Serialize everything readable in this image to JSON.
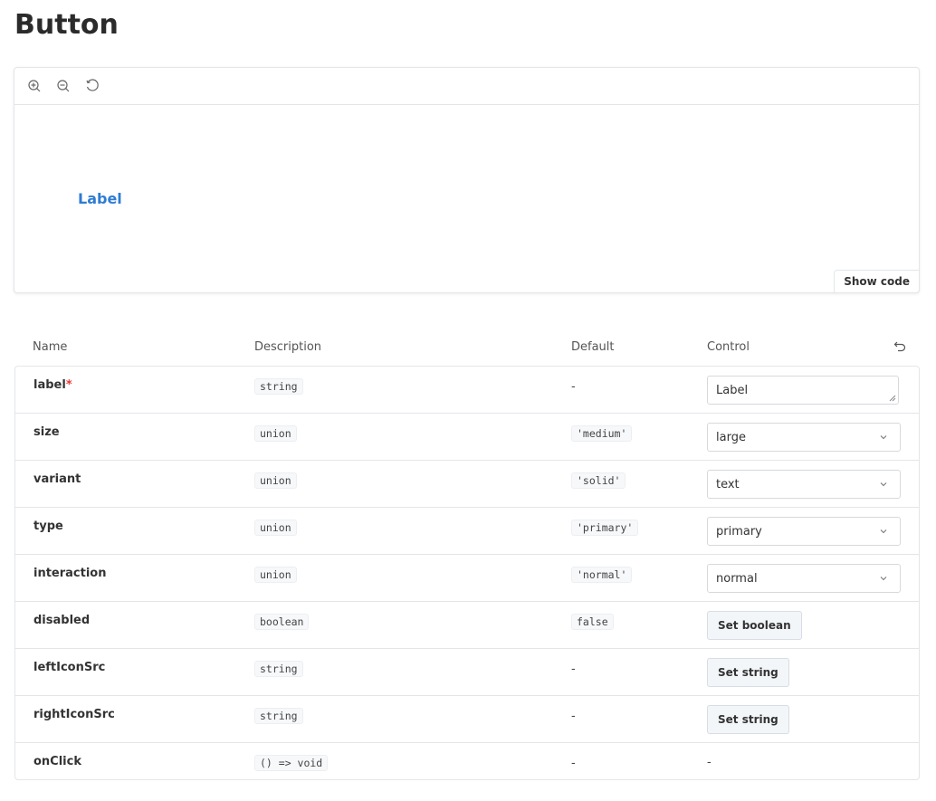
{
  "page": {
    "title": "Button"
  },
  "toolbar": {
    "zoom_in_icon": "zoom-in-icon",
    "zoom_out_icon": "zoom-out-icon",
    "reset_zoom_icon": "reset-zoom-icon"
  },
  "preview": {
    "button_label": "Label",
    "button_color": "#2f7cd3",
    "show_code_label": "Show code"
  },
  "args_table": {
    "headers": {
      "name": "Name",
      "description": "Description",
      "default": "Default",
      "control": "Control"
    },
    "reset_icon": "undo-icon",
    "required_marker": "*",
    "rows": [
      {
        "name": "label",
        "required": true,
        "type": "string",
        "default": "-",
        "control": {
          "kind": "text",
          "value": "Label"
        }
      },
      {
        "name": "size",
        "type": "union",
        "default": "'medium'",
        "control": {
          "kind": "select",
          "value": "large"
        }
      },
      {
        "name": "variant",
        "type": "union",
        "default": "'solid'",
        "control": {
          "kind": "select",
          "value": "text"
        }
      },
      {
        "name": "type",
        "type": "union",
        "default": "'primary'",
        "control": {
          "kind": "select",
          "value": "primary"
        }
      },
      {
        "name": "interaction",
        "type": "union",
        "default": "'normal'",
        "control": {
          "kind": "select",
          "value": "normal"
        }
      },
      {
        "name": "disabled",
        "type": "boolean",
        "default": "false",
        "control": {
          "kind": "button",
          "value": "Set boolean"
        }
      },
      {
        "name": "leftIconSrc",
        "type": "string",
        "default": "-",
        "control": {
          "kind": "button",
          "value": "Set string"
        }
      },
      {
        "name": "rightIconSrc",
        "type": "string",
        "default": "-",
        "control": {
          "kind": "button",
          "value": "Set string"
        }
      },
      {
        "name": "onClick",
        "type": "() => void",
        "default": "-",
        "control": {
          "kind": "none",
          "value": "-"
        }
      }
    ]
  }
}
